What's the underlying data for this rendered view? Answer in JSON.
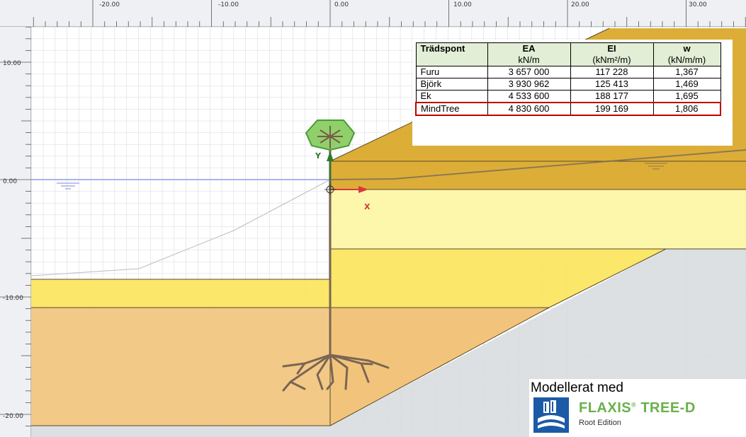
{
  "rulers": {
    "x_ticks": [
      "-20.00",
      "-10.00",
      "0.00",
      "10.00",
      "20.00",
      "30.00"
    ],
    "y_ticks": [
      "10.00",
      "0.00",
      "-10.00",
      "-20.00"
    ]
  },
  "axes": {
    "x_label": "X",
    "y_label": "Y"
  },
  "material_table": {
    "headers": [
      {
        "top": "Trädspont",
        "bottom": ""
      },
      {
        "top": "EA",
        "bottom": "kN/m"
      },
      {
        "top": "EI",
        "bottom": "(kNm²/m)"
      },
      {
        "top": "w",
        "bottom": "(kN/m/m)"
      }
    ],
    "rows": [
      {
        "name": "Furu",
        "ea": "3 657 000",
        "ei": "117 228",
        "w": "1,367"
      },
      {
        "name": "Björk",
        "ea": "3 930 962",
        "ei": "125 413",
        "w": "1,469"
      },
      {
        "name": "Ek",
        "ea": "4 533 600",
        "ei": "188 177",
        "w": "1,695"
      },
      {
        "name": "MindTree",
        "ea": "4 830 600",
        "ei": "199 169",
        "w": "1,806",
        "highlight": true
      }
    ]
  },
  "branding": {
    "caption": "Modellerat med",
    "product": "FLAXIS",
    "product_reg": "®",
    "product_suffix": " TREE-D",
    "edition": "Root Edition"
  },
  "colors": {
    "grid": "#c8ccd2",
    "soil_dark": "#d9a521",
    "soil_light": "#fdf7a8",
    "soil_yellow": "#fbe55a",
    "soil_orange": "#f2c37a",
    "bedrock": "#d6dade",
    "water_line": "#a9b4f0",
    "tree_crown": "#8fd06a",
    "axis_y": "#2d7a2d",
    "axis_x": "#d43b3b"
  }
}
